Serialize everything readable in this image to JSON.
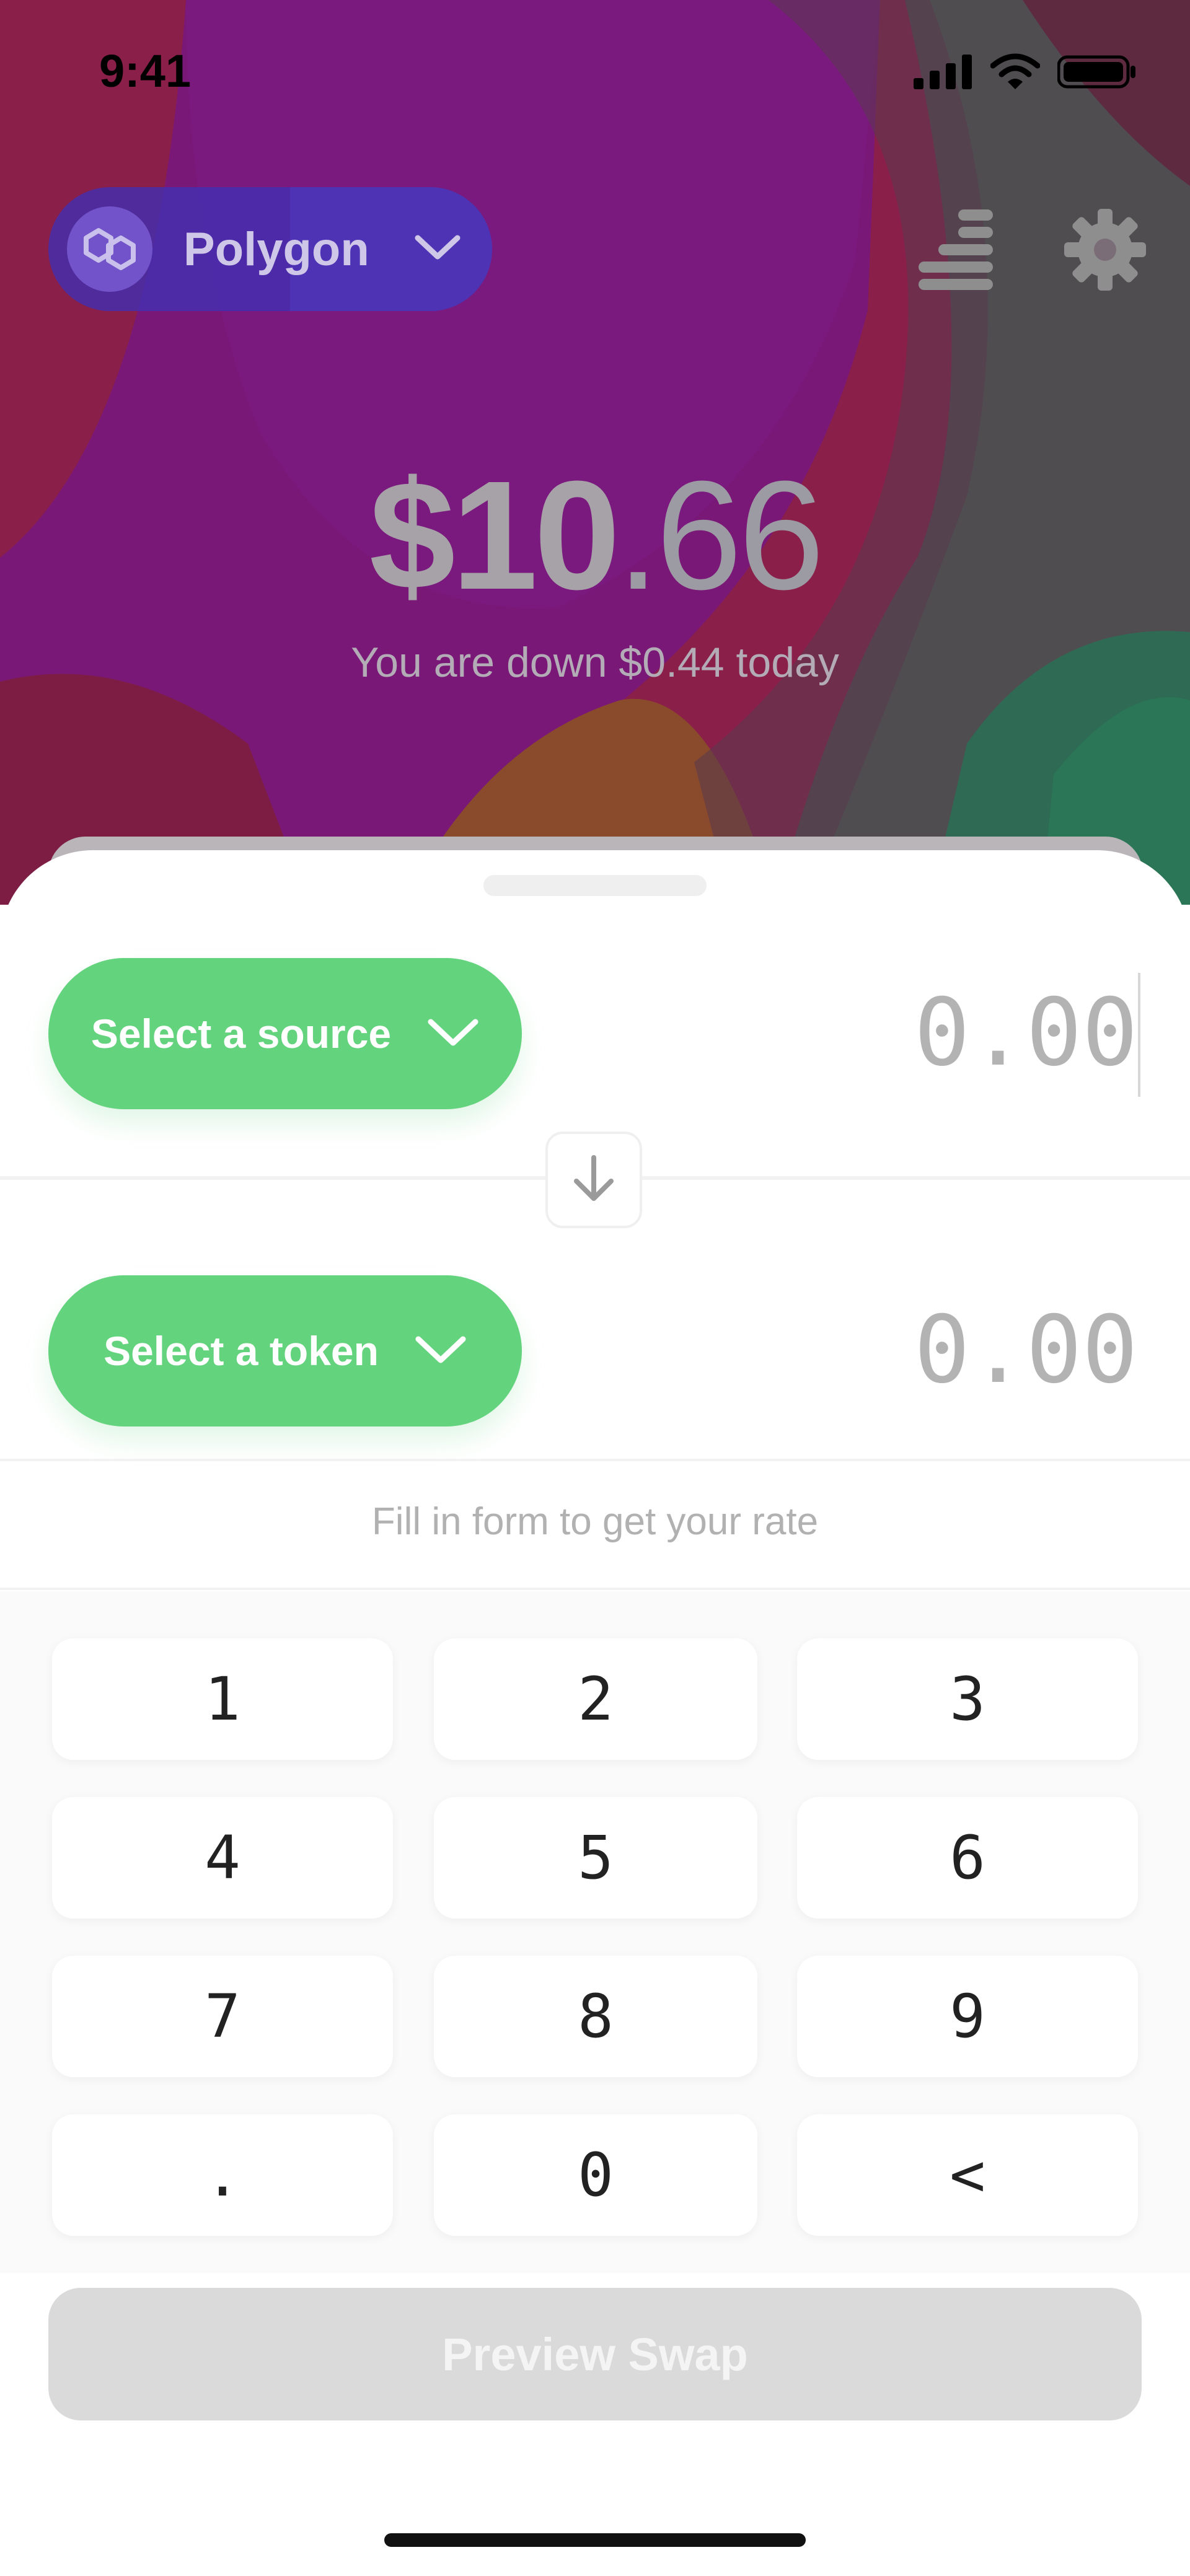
{
  "status_bar": {
    "time": "9:41"
  },
  "network": {
    "name": "Polygon"
  },
  "balance": {
    "whole": "$10",
    "cents": ".66",
    "delta_text": "You are down $0.44 today"
  },
  "swap": {
    "source_label": "Select a source",
    "token_label": "Select a token",
    "source_amount": "0.00",
    "token_amount": "0.00",
    "rate_note": "Fill in form to get your rate"
  },
  "keypad": {
    "keys": [
      "1",
      "2",
      "3",
      "4",
      "5",
      "6",
      "7",
      "8",
      "9",
      ".",
      "0",
      "<"
    ]
  },
  "preview_button": "Preview Swap",
  "icons": [
    "signal-icon",
    "wifi-icon",
    "battery-icon",
    "polygon-logo-icon",
    "chevron-down-icon",
    "stack-icon",
    "gear-icon",
    "arrow-down-icon"
  ],
  "colors": {
    "accent": "#64d37e",
    "disabled": "#dadada"
  }
}
